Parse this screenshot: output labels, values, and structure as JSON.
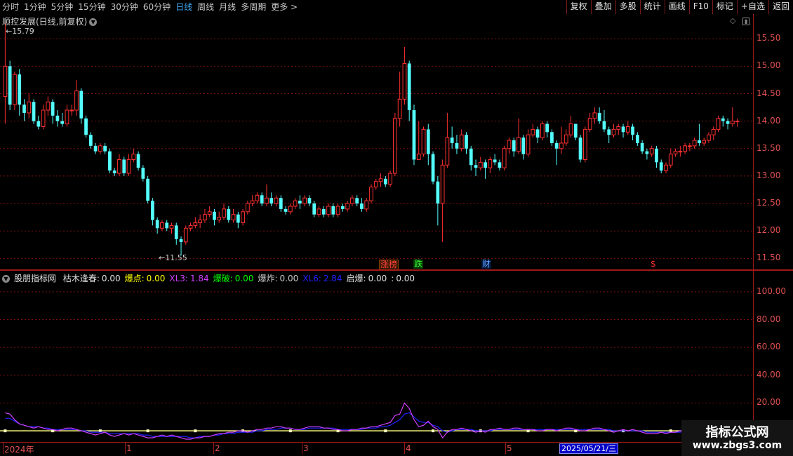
{
  "toolbar": {
    "periods": [
      "分时",
      "1分钟",
      "5分钟",
      "15分钟",
      "30分钟",
      "60分钟",
      "日线",
      "周线",
      "月线",
      "多周期",
      "更多 >"
    ],
    "active_period": "日线",
    "buttons": [
      "复权",
      "叠加",
      "多股",
      "统计",
      "画线",
      "F10",
      "标记",
      "+自选",
      "返回"
    ]
  },
  "main": {
    "title": "顺控发展(日线,前复权)",
    "high_label": "15.79",
    "low_label": "11.55",
    "y_ticks": [
      "15.50",
      "15.00",
      "14.50",
      "14.00",
      "13.50",
      "13.00",
      "12.50",
      "12.00",
      "11.50"
    ],
    "events": [
      {
        "text": "涨榜",
        "color": "#ff4040",
        "bg": "#3a1a00"
      },
      {
        "text": "跌",
        "color": "#40ff40",
        "bg": "#003a00"
      },
      {
        "text": "财",
        "color": "#60a0ff",
        "bg": "#00183a"
      },
      {
        "text": "$",
        "color": "#ff3030",
        "bg": ""
      }
    ]
  },
  "indicator": {
    "name": "股朋指标网",
    "items": [
      {
        "label": "枯木逢春:",
        "value": "0.00",
        "color": "#e0e0e0"
      },
      {
        "label": "爆点:",
        "value": "0.00",
        "color": "#ffff00"
      },
      {
        "label": "XL3:",
        "value": "1.84",
        "color": "#d040ff"
      },
      {
        "label": "爆破:",
        "value": "0.00",
        "color": "#00ff00"
      },
      {
        "label": "爆炸:",
        "value": "0.00",
        "color": "#c8c8c8"
      },
      {
        "label": "XL6:",
        "value": "2.84",
        "color": "#2020ff"
      },
      {
        "label": "启爆:",
        "value": "0.00",
        "color": "#e0e0e0"
      },
      {
        "label": ":",
        "value": "0.00",
        "color": "#e0e0e0"
      }
    ],
    "y_ticks": [
      "100.00",
      "80.00",
      "60.00",
      "40.00",
      "20.00"
    ]
  },
  "date_axis": {
    "labels": [
      "2024年",
      "1",
      "2",
      "3",
      "4",
      "5"
    ],
    "current_date": "2025/05/21/三"
  },
  "watermark": {
    "title": "指标公式网",
    "url": "www.zbgs3.com"
  },
  "chart_data": {
    "type": "candlestick",
    "up_color": "#ff3030",
    "down_color": "#54ffff",
    "ylim": [
      11.3,
      15.95
    ],
    "y_ticks": [
      15.5,
      15.0,
      14.5,
      14.0,
      13.5,
      13.0,
      12.5,
      12.0,
      11.5
    ],
    "candles": [
      [
        14.45,
        15.0,
        15.79,
        13.95
      ],
      [
        15.0,
        14.3,
        15.1,
        14.2
      ],
      [
        14.3,
        14.85,
        14.9,
        14.2
      ],
      [
        14.85,
        14.3,
        14.95,
        14.1
      ],
      [
        14.3,
        14.15,
        14.4,
        14.0
      ],
      [
        14.15,
        14.35,
        14.5,
        14.05
      ],
      [
        14.35,
        14.0,
        14.4,
        13.95
      ],
      [
        14.0,
        13.9,
        14.1,
        13.85
      ],
      [
        13.9,
        14.2,
        14.3,
        13.85
      ],
      [
        14.2,
        14.35,
        14.45,
        14.1
      ],
      [
        14.35,
        14.1,
        14.4,
        13.95
      ],
      [
        14.1,
        14.0,
        14.2,
        13.9
      ],
      [
        14.0,
        13.95,
        14.15,
        13.9
      ],
      [
        13.95,
        14.2,
        14.3,
        13.9
      ],
      [
        14.2,
        14.2,
        14.3,
        14.1
      ],
      [
        14.2,
        14.55,
        14.75,
        14.1
      ],
      [
        14.55,
        14.05,
        14.6,
        13.95
      ],
      [
        14.05,
        13.75,
        14.1,
        13.7
      ],
      [
        13.75,
        13.55,
        13.8,
        13.5
      ],
      [
        13.55,
        13.45,
        13.6,
        13.4
      ],
      [
        13.45,
        13.55,
        13.6,
        13.4
      ],
      [
        13.55,
        13.45,
        13.6,
        13.4
      ],
      [
        13.45,
        13.1,
        13.5,
        13.05
      ],
      [
        13.1,
        13.05,
        13.15,
        13.0
      ],
      [
        13.05,
        13.3,
        13.4,
        13.0
      ],
      [
        13.3,
        13.05,
        13.35,
        13.0
      ],
      [
        13.05,
        13.3,
        13.4,
        13.0
      ],
      [
        13.3,
        13.4,
        13.5,
        13.25
      ],
      [
        13.4,
        13.15,
        13.45,
        13.1
      ],
      [
        13.15,
        12.95,
        13.2,
        12.9
      ],
      [
        12.95,
        12.55,
        13.0,
        12.5
      ],
      [
        12.55,
        12.2,
        12.6,
        12.1
      ],
      [
        12.2,
        12.05,
        12.25,
        11.95
      ],
      [
        12.05,
        12.15,
        12.2,
        12.0
      ],
      [
        12.15,
        12.05,
        12.2,
        12.0
      ],
      [
        12.05,
        12.1,
        12.15,
        11.95
      ],
      [
        12.1,
        11.85,
        12.15,
        11.75
      ],
      [
        11.85,
        11.8,
        11.9,
        11.55
      ],
      [
        11.8,
        12.05,
        12.1,
        11.75
      ],
      [
        12.05,
        12.1,
        12.15,
        12.0
      ],
      [
        12.1,
        12.15,
        12.25,
        12.05
      ],
      [
        12.15,
        12.2,
        12.3,
        12.05
      ],
      [
        12.2,
        12.3,
        12.4,
        12.15
      ],
      [
        12.3,
        12.35,
        12.45,
        12.25
      ],
      [
        12.35,
        12.2,
        12.4,
        12.1
      ],
      [
        12.2,
        12.25,
        12.35,
        12.15
      ],
      [
        12.25,
        12.4,
        12.5,
        12.2
      ],
      [
        12.4,
        12.2,
        12.45,
        12.15
      ],
      [
        12.2,
        12.3,
        12.4,
        12.15
      ],
      [
        12.3,
        12.15,
        12.35,
        12.05
      ],
      [
        12.15,
        12.35,
        12.4,
        12.1
      ],
      [
        12.35,
        12.5,
        12.55,
        12.3
      ],
      [
        12.5,
        12.55,
        12.65,
        12.45
      ],
      [
        12.55,
        12.65,
        12.7,
        12.5
      ],
      [
        12.65,
        12.5,
        12.7,
        12.45
      ],
      [
        12.5,
        12.6,
        12.85,
        12.45
      ],
      [
        12.6,
        12.5,
        12.7,
        12.45
      ],
      [
        12.5,
        12.6,
        12.65,
        12.45
      ],
      [
        12.6,
        12.4,
        12.65,
        12.35
      ],
      [
        12.4,
        12.35,
        12.45,
        12.3
      ],
      [
        12.35,
        12.45,
        12.5,
        12.3
      ],
      [
        12.45,
        12.55,
        12.6,
        12.4
      ],
      [
        12.55,
        12.5,
        12.65,
        12.4
      ],
      [
        12.5,
        12.6,
        12.65,
        12.45
      ],
      [
        12.6,
        12.5,
        12.65,
        12.45
      ],
      [
        12.5,
        12.3,
        12.55,
        12.25
      ],
      [
        12.3,
        12.4,
        12.45,
        12.25
      ],
      [
        12.4,
        12.3,
        12.45,
        12.25
      ],
      [
        12.3,
        12.45,
        12.5,
        12.25
      ],
      [
        12.45,
        12.3,
        12.5,
        12.25
      ],
      [
        12.3,
        12.45,
        12.5,
        12.25
      ],
      [
        12.45,
        12.4,
        12.5,
        12.35
      ],
      [
        12.4,
        12.5,
        12.55,
        12.35
      ],
      [
        12.5,
        12.6,
        12.65,
        12.45
      ],
      [
        12.6,
        12.5,
        12.65,
        12.45
      ],
      [
        12.5,
        12.4,
        12.6,
        12.35
      ],
      [
        12.4,
        12.55,
        12.6,
        12.35
      ],
      [
        12.55,
        12.8,
        12.85,
        12.5
      ],
      [
        12.8,
        12.9,
        12.95,
        12.75
      ],
      [
        12.9,
        12.95,
        13.05,
        12.8
      ],
      [
        12.95,
        12.85,
        13.0,
        12.8
      ],
      [
        12.85,
        13.05,
        13.1,
        12.8
      ],
      [
        13.05,
        14.05,
        14.15,
        13.0
      ],
      [
        14.05,
        14.4,
        14.9,
        13.9
      ],
      [
        14.4,
        15.05,
        15.35,
        14.3
      ],
      [
        15.05,
        14.2,
        15.1,
        14.0
      ],
      [
        14.2,
        13.3,
        14.3,
        13.2
      ],
      [
        13.3,
        13.4,
        14.0,
        13.3
      ],
      [
        13.4,
        13.85,
        13.9,
        13.35
      ],
      [
        13.85,
        13.4,
        13.95,
        13.2
      ],
      [
        13.4,
        12.9,
        13.45,
        12.85
      ],
      [
        12.9,
        12.5,
        13.0,
        12.1
      ],
      [
        12.5,
        13.2,
        13.3,
        11.8
      ],
      [
        13.2,
        13.7,
        14.15,
        13.15
      ],
      [
        13.7,
        13.6,
        13.9,
        13.5
      ],
      [
        13.6,
        13.5,
        13.75,
        13.4
      ],
      [
        13.5,
        13.75,
        13.85,
        13.45
      ],
      [
        13.75,
        13.5,
        13.8,
        13.4
      ],
      [
        13.5,
        13.2,
        13.55,
        13.1
      ],
      [
        13.2,
        13.15,
        13.3,
        13.0
      ],
      [
        13.15,
        13.25,
        13.35,
        13.1
      ],
      [
        13.25,
        13.15,
        13.3,
        12.95
      ],
      [
        13.15,
        13.3,
        13.35,
        13.05
      ],
      [
        13.3,
        13.25,
        13.4,
        13.2
      ],
      [
        13.25,
        13.15,
        13.3,
        13.1
      ],
      [
        13.15,
        13.5,
        13.55,
        13.1
      ],
      [
        13.5,
        13.65,
        13.7,
        13.4
      ],
      [
        13.65,
        13.45,
        13.7,
        13.35
      ],
      [
        13.45,
        13.7,
        14.05,
        13.4
      ],
      [
        13.7,
        13.4,
        13.75,
        13.3
      ],
      [
        13.4,
        13.75,
        13.85,
        13.35
      ],
      [
        13.75,
        13.85,
        13.95,
        13.7
      ],
      [
        13.85,
        13.7,
        13.9,
        13.6
      ],
      [
        13.7,
        13.95,
        14.0,
        13.65
      ],
      [
        13.95,
        13.8,
        14.0,
        13.7
      ],
      [
        13.8,
        13.6,
        13.85,
        13.55
      ],
      [
        13.6,
        13.5,
        13.65,
        13.2
      ],
      [
        13.5,
        13.6,
        13.9,
        13.4
      ],
      [
        13.6,
        13.75,
        13.85,
        13.55
      ],
      [
        13.75,
        13.95,
        14.1,
        13.7
      ],
      [
        13.95,
        13.7,
        13.95,
        13.65
      ],
      [
        13.7,
        13.3,
        13.75,
        13.25
      ],
      [
        13.3,
        13.85,
        13.9,
        13.25
      ],
      [
        13.85,
        14.05,
        14.15,
        13.8
      ],
      [
        14.05,
        14.15,
        14.25,
        13.95
      ],
      [
        14.15,
        14.0,
        14.25,
        13.95
      ],
      [
        14.0,
        13.85,
        14.2,
        13.8
      ],
      [
        13.85,
        13.75,
        13.9,
        13.6
      ],
      [
        13.75,
        13.85,
        13.95,
        13.7
      ],
      [
        13.85,
        13.9,
        13.95,
        13.75
      ],
      [
        13.9,
        13.8,
        13.95,
        13.7
      ],
      [
        13.8,
        13.9,
        14.0,
        13.75
      ],
      [
        13.9,
        13.75,
        13.95,
        13.65
      ],
      [
        13.75,
        13.6,
        13.8,
        13.55
      ],
      [
        13.6,
        13.45,
        13.65,
        13.4
      ],
      [
        13.45,
        13.4,
        13.5,
        13.3
      ],
      [
        13.4,
        13.5,
        13.55,
        13.35
      ],
      [
        13.5,
        13.25,
        13.55,
        13.15
      ],
      [
        13.25,
        13.1,
        13.3,
        13.05
      ],
      [
        13.1,
        13.2,
        13.25,
        13.05
      ],
      [
        13.2,
        13.4,
        13.5,
        13.15
      ],
      [
        13.4,
        13.45,
        13.5,
        13.35
      ],
      [
        13.45,
        13.45,
        13.55,
        13.35
      ],
      [
        13.45,
        13.55,
        13.6,
        13.4
      ],
      [
        13.55,
        13.55,
        13.6,
        13.45
      ],
      [
        13.55,
        13.65,
        13.7,
        13.5
      ],
      [
        13.65,
        13.6,
        13.95,
        13.55
      ],
      [
        13.6,
        13.65,
        13.7,
        13.55
      ],
      [
        13.65,
        13.75,
        13.8,
        13.6
      ],
      [
        13.75,
        13.85,
        13.9,
        13.65
      ],
      [
        13.85,
        14.05,
        14.1,
        13.8
      ],
      [
        14.05,
        14.0,
        14.1,
        13.9
      ],
      [
        14.0,
        13.95,
        14.05,
        13.85
      ],
      [
        13.95,
        14.0,
        14.25,
        13.9
      ],
      [
        14.0,
        14.0,
        14.05,
        13.9
      ]
    ],
    "indicator_series": [
      {
        "name": "XL3",
        "color": "#d040ff",
        "values": [
          13,
          12,
          8,
          5,
          4,
          3,
          2,
          3,
          2,
          1,
          1,
          0,
          1,
          2,
          2,
          1,
          0,
          -1,
          -2,
          -3,
          -2,
          -1,
          -3,
          -4,
          -3,
          -2,
          -3,
          -2,
          -3,
          -4,
          -5,
          -5,
          -4,
          -3,
          -4,
          -3,
          -4,
          -5,
          -6,
          -6,
          -5,
          -5,
          -4,
          -4,
          -3,
          -2,
          -2,
          -1,
          -1,
          0,
          0,
          -1,
          0,
          1,
          1,
          2,
          2,
          3,
          3,
          2,
          2,
          1,
          1,
          2,
          3,
          3,
          3,
          2,
          2,
          1,
          1,
          0,
          0,
          1,
          1,
          2,
          2,
          3,
          3,
          4,
          5,
          6,
          11,
          12,
          20,
          16,
          8,
          3,
          4,
          7,
          3,
          1,
          -5,
          -1,
          1,
          1,
          2,
          1,
          0,
          -1,
          0,
          -1,
          1,
          1,
          2,
          1,
          1,
          2,
          2,
          1,
          1,
          1,
          0,
          0,
          1,
          1,
          0,
          1,
          2,
          2,
          1,
          0,
          0,
          1,
          2,
          2,
          1,
          0,
          -1,
          0,
          1,
          0,
          1,
          0,
          -1,
          -2,
          -2,
          -2,
          -1,
          -2,
          -1,
          -1,
          0,
          1,
          2,
          1,
          2,
          1,
          2,
          2,
          2,
          3,
          3,
          2,
          2,
          2,
          3,
          3
        ]
      },
      {
        "name": "XL6",
        "color": "#2020ff",
        "values": [
          9,
          9,
          7,
          5,
          4,
          3,
          3,
          3,
          2,
          2,
          1,
          1,
          1,
          1,
          1,
          1,
          0,
          0,
          -1,
          -1,
          -1,
          -1,
          -2,
          -2,
          -2,
          -2,
          -2,
          -2,
          -2,
          -3,
          -3,
          -4,
          -4,
          -4,
          -4,
          -4,
          -4,
          -4,
          -4,
          -5,
          -5,
          -4,
          -4,
          -4,
          -3,
          -3,
          -2,
          -2,
          -2,
          -1,
          -1,
          -1,
          -1,
          0,
          0,
          1,
          1,
          1,
          2,
          2,
          2,
          1,
          1,
          1,
          2,
          2,
          2,
          2,
          2,
          2,
          1,
          1,
          1,
          1,
          1,
          1,
          2,
          2,
          2,
          3,
          3,
          4,
          6,
          8,
          12,
          13,
          10,
          7,
          6,
          6,
          4,
          3,
          0,
          -1,
          0,
          1,
          1,
          1,
          1,
          0,
          0,
          0,
          0,
          1,
          1,
          1,
          1,
          1,
          1,
          1,
          1,
          1,
          1,
          1,
          1,
          1,
          1,
          1,
          1,
          1,
          1,
          1,
          1,
          1,
          1,
          1,
          1,
          1,
          0,
          0,
          0,
          0,
          0,
          0,
          0,
          -1,
          -1,
          -1,
          -1,
          -1,
          -1,
          -1,
          -1,
          0,
          0,
          1,
          1,
          1,
          1,
          1,
          2,
          2,
          2,
          2,
          2,
          2,
          2,
          2
        ]
      },
      {
        "name": "启爆",
        "color": "#ffff80",
        "values": [
          0
        ]
      }
    ],
    "indicator_ylim": [
      -8,
      108
    ],
    "indicator_y_ticks": [
      100,
      80,
      60,
      40,
      20
    ]
  }
}
